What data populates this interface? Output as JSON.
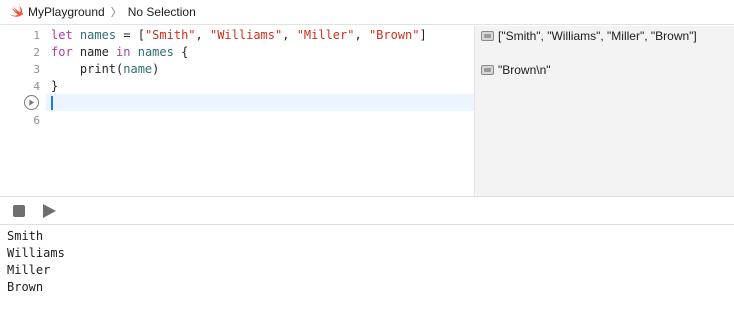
{
  "jumpbar": {
    "icon": "swift-icon",
    "project": "MyPlayground",
    "separator": "〉",
    "selection": "No Selection"
  },
  "editor": {
    "line_numbers": [
      "1",
      "2",
      "3",
      "4",
      "",
      "6"
    ],
    "lines": [
      [
        {
          "t": "let",
          "c": "kw"
        },
        {
          "t": " "
        },
        {
          "t": "names",
          "c": "ident"
        },
        {
          "t": " = ["
        },
        {
          "t": "\"Smith\"",
          "c": "str"
        },
        {
          "t": ", "
        },
        {
          "t": "\"Williams\"",
          "c": "str"
        },
        {
          "t": ", "
        },
        {
          "t": "\"Miller\"",
          "c": "str"
        },
        {
          "t": ", "
        },
        {
          "t": "\"Brown\"",
          "c": "str"
        },
        {
          "t": "]"
        }
      ],
      [
        {
          "t": "for",
          "c": "kw"
        },
        {
          "t": " name "
        },
        {
          "t": "in",
          "c": "kw"
        },
        {
          "t": " "
        },
        {
          "t": "names",
          "c": "ident"
        },
        {
          "t": " {"
        }
      ],
      [
        {
          "t": "    print("
        },
        {
          "t": "name",
          "c": "ident"
        },
        {
          "t": ")"
        }
      ],
      [
        {
          "t": "}"
        }
      ],
      [],
      []
    ],
    "run_marker_icon": "play-circle-icon"
  },
  "results": [
    {
      "text": "[\"Smith\", \"Williams\", \"Miller\", \"Brown\"]",
      "icon": "quick-look-icon"
    },
    {
      "text": "\"Brown\\n\"",
      "icon": "quick-look-icon"
    }
  ],
  "debug": {
    "stop_icon": "stop-icon",
    "run_icon": "play-icon"
  },
  "console": {
    "lines": [
      "Smith",
      "Williams",
      "Miller",
      "Brown"
    ]
  },
  "colors": {
    "keyword": "#ad3da4",
    "string": "#d12f1b",
    "identifier": "#326d74",
    "current_line": "#ecf5ff",
    "results_bg": "#f3f3f3"
  }
}
